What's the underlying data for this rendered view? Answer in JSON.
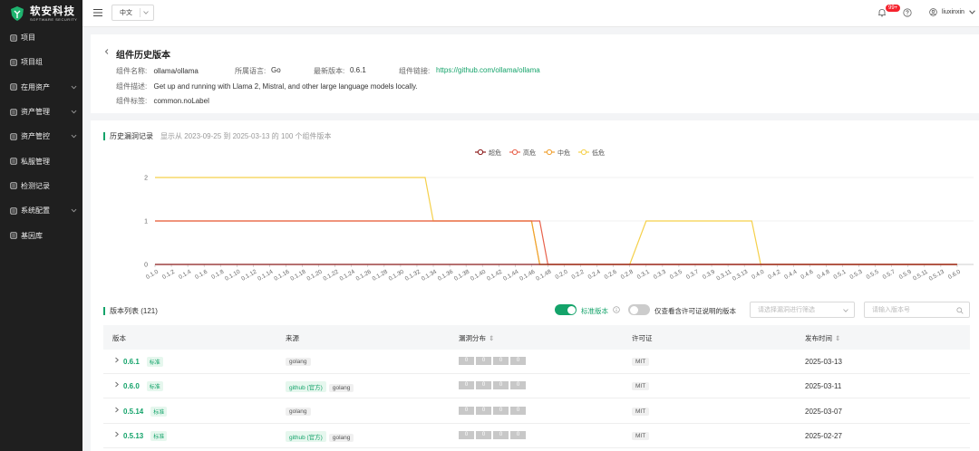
{
  "logo": {
    "name_cn": "软安科技",
    "name_en": "SOFTWARE SECURITY"
  },
  "sidebar": {
    "items": [
      {
        "label": "项目",
        "icon": "project-icon",
        "has_children": false
      },
      {
        "label": "项目组",
        "icon": "project-group-icon",
        "has_children": false
      },
      {
        "label": "在用资产",
        "icon": "asset-icon",
        "has_children": true
      },
      {
        "label": "资产管理",
        "icon": "asset-manage-icon",
        "has_children": true
      },
      {
        "label": "资产管控",
        "icon": "asset-control-icon",
        "has_children": true
      },
      {
        "label": "私服管理",
        "icon": "server-icon",
        "has_children": false
      },
      {
        "label": "检测记录",
        "icon": "record-icon",
        "has_children": false
      },
      {
        "label": "系统配置",
        "icon": "settings-icon",
        "has_children": true
      },
      {
        "label": "基因库",
        "icon": "gene-library-icon",
        "has_children": false
      }
    ]
  },
  "header": {
    "language": "中文",
    "notification_badge": "99+",
    "username": "liuxinxin"
  },
  "info": {
    "title": "组件历史版本",
    "name_label": "组件名称:",
    "name_value": "ollama/ollama",
    "lang_label": "所属语言:",
    "lang_value": "Go",
    "latest_label": "最新版本:",
    "latest_value": "0.6.1",
    "link_label": "组件链接:",
    "link_value": "https://github.com/ollama/ollama",
    "desc_label": "组件描述:",
    "desc_value": "Get up and running with Llama 2, Mistral, and other large language models locally.",
    "tag_label": "组件标签:",
    "tag_value": "common.noLabel"
  },
  "chart_section": {
    "title": "历史漏洞记录",
    "subtitle": "显示从 2023-09-25 到 2025-03-13 的 100 个组件版本"
  },
  "chart_data": {
    "type": "line",
    "ylim": [
      0,
      2
    ],
    "yticks": [
      "0",
      "1",
      "2"
    ],
    "x_tick_labels": [
      "0.1.0",
      "0.1.2",
      "0.1.4",
      "0.1.6",
      "0.1.8",
      "0.1.10",
      "0.1.12",
      "0.1.14",
      "0.1.16",
      "0.1.18",
      "0.1.20",
      "0.1.22",
      "0.1.24",
      "0.1.26",
      "0.1.28",
      "0.1.30",
      "0.1.32",
      "0.1.34",
      "0.1.36",
      "0.1.38",
      "0.1.40",
      "0.1.42",
      "0.1.44",
      "0.1.46",
      "0.1.48",
      "0.2.0",
      "0.2.2",
      "0.2.4",
      "0.2.6",
      "0.2.8",
      "0.3.1",
      "0.3.3",
      "0.3.5",
      "0.3.7",
      "0.3.9",
      "0.3.11",
      "0.3.13",
      "0.4.0",
      "0.4.2",
      "0.4.4",
      "0.4.6",
      "0.4.8",
      "0.5.1",
      "0.5.3",
      "0.5.5",
      "0.5.7",
      "0.5.9",
      "0.5.11",
      "0.5.13",
      "0.6.0"
    ],
    "legend": [
      "超危",
      "高危",
      "中危",
      "低危"
    ],
    "colors": {
      "超危": "#8b1a1a",
      "高危": "#e8624c",
      "中危": "#f0a030",
      "低危": "#f5d04a"
    },
    "series": [
      {
        "name": "超危",
        "points": [
          [
            "0.1.0",
            0
          ],
          [
            "0.6.0",
            0
          ]
        ]
      },
      {
        "name": "高危",
        "points": [
          [
            "0.1.0",
            1
          ],
          [
            "0.1.46",
            1
          ],
          [
            "0.1.47",
            1
          ],
          [
            "0.1.48",
            0
          ],
          [
            "0.6.0",
            0
          ]
        ]
      },
      {
        "name": "中危",
        "points": [
          [
            "0.1.0",
            1
          ],
          [
            "0.1.46",
            1
          ],
          [
            "0.1.47",
            0
          ],
          [
            "0.6.0",
            0
          ]
        ]
      },
      {
        "name": "低危",
        "points": [
          [
            "0.1.0",
            2
          ],
          [
            "0.1.33",
            2
          ],
          [
            "0.1.34",
            1
          ],
          [
            "0.1.46",
            1
          ],
          [
            "0.1.47",
            0
          ],
          [
            "0.2.8",
            0
          ],
          [
            "0.3.1",
            1
          ],
          [
            "0.3.14",
            1
          ],
          [
            "0.4.0",
            0
          ],
          [
            "0.6.0",
            0
          ]
        ]
      }
    ]
  },
  "table_section": {
    "title": "版本列表 (121)",
    "toggle1_label": "标准版本",
    "toggle2_label": "仅查看含许可证说明的版本",
    "filter_placeholder": "请选择漏洞进行筛选",
    "search_placeholder": "请输入版本号",
    "columns": [
      "版本",
      "来源",
      "漏洞分布",
      "许可证",
      "发布时间"
    ],
    "rows": [
      {
        "version": "0.6.1",
        "tag": "标准",
        "sources": [
          {
            "text": "golang",
            "green": false
          }
        ],
        "vulns": [
          "0",
          "0",
          "0",
          "0"
        ],
        "license": "MIT",
        "date": "2025-03-13"
      },
      {
        "version": "0.6.0",
        "tag": "标准",
        "sources": [
          {
            "text": "github (官方)",
            "green": true
          },
          {
            "text": "golang",
            "green": false
          }
        ],
        "vulns": [
          "0",
          "0",
          "0",
          "0"
        ],
        "license": "MIT",
        "date": "2025-03-11"
      },
      {
        "version": "0.5.14",
        "tag": "标准",
        "sources": [
          {
            "text": "golang",
            "green": false
          }
        ],
        "vulns": [
          "0",
          "0",
          "0",
          "0"
        ],
        "license": "MIT",
        "date": "2025-03-07"
      },
      {
        "version": "0.5.13",
        "tag": "标准",
        "sources": [
          {
            "text": "github (官方)",
            "green": true
          },
          {
            "text": "golang",
            "green": false
          }
        ],
        "vulns": [
          "0",
          "0",
          "0",
          "0"
        ],
        "license": "MIT",
        "date": "2025-02-27"
      }
    ]
  }
}
